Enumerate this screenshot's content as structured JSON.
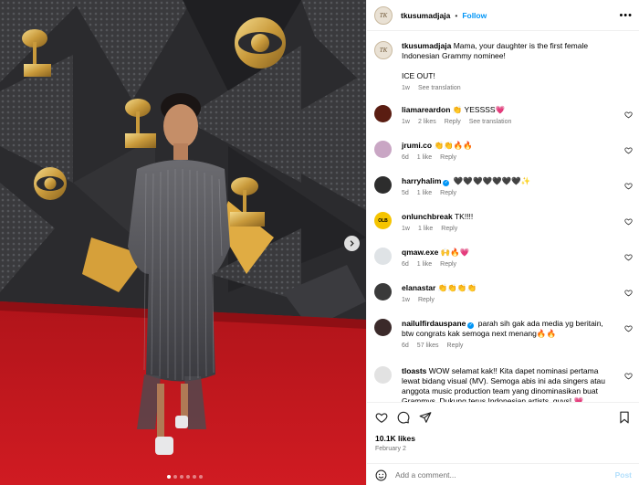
{
  "post": {
    "username": "tkusumadjaja",
    "separator": "•",
    "follow_label": "Follow",
    "more_label": "•••",
    "caption_line1": "Mama, your daughter is the first female Indonesian Grammy nominee!",
    "caption_line2": "ICE OUT!",
    "caption_time": "1w",
    "see_translation": "See translation",
    "avatar_text": "TK",
    "slide_count": 6,
    "active_slide": 0
  },
  "comments": [
    {
      "user": "liamareardon",
      "text": "👏 YESSSS💗",
      "time": "1w",
      "likes": "2 likes",
      "reply": "Reply",
      "translation": "See translation",
      "avatar_color": "#5a1d12",
      "verified": false
    },
    {
      "user": "jrumi.co",
      "text": "👏👏🔥🔥",
      "time": "6d",
      "likes": "1 like",
      "reply": "Reply",
      "avatar_color": "#c9a6c4",
      "verified": false
    },
    {
      "user": "harryhalim",
      "text": "🖤🖤🖤🖤🖤🖤🖤✨",
      "time": "5d",
      "likes": "1 like",
      "reply": "Reply",
      "avatar_color": "#2d2d2d",
      "verified": true
    },
    {
      "user": "onlunchbreak",
      "text": "TK!!!!",
      "time": "1w",
      "likes": "1 like",
      "reply": "Reply",
      "avatar_color": "#f5c400",
      "avatar_label": "OLB",
      "verified": false
    },
    {
      "user": "qmaw.exe",
      "text": "🙌🔥💗",
      "time": "6d",
      "likes": "1 like",
      "reply": "Reply",
      "avatar_color": "#dfe3e6",
      "verified": false
    },
    {
      "user": "elanastar",
      "text": "👏👏👏👏",
      "time": "1w",
      "reply": "Reply",
      "avatar_color": "#3a3a3a",
      "verified": false
    },
    {
      "user": "nailulfirdauspane",
      "text": "parah sih gak ada media yg beritain, btw congrats kak semoga next menang🔥🔥",
      "time": "6d",
      "likes": "57 likes",
      "reply": "Reply",
      "avatar_color": "#3b2a2a",
      "verified": true
    },
    {
      "user": "tloasts",
      "text": "WOW selamat kak!! Kita dapet nominasi pertama lewat bidang visual (MV). Semoga abis ini ada singers atau anggota music production team yang dinominasikan buat Grammys. Dukung terus Indonesian artists, guys! 💗",
      "avatar_color": "#e2e2e2",
      "verified": false
    }
  ],
  "footer": {
    "likes": "10.1K likes",
    "date": "February 2",
    "add_placeholder": "Add a comment...",
    "post_label": "Post"
  },
  "icons": [
    "heart-icon",
    "comment-icon",
    "share-icon",
    "bookmark-icon",
    "emoji-icon",
    "chevron-right-icon",
    "more-icon",
    "verified-icon"
  ],
  "colors": {
    "follow": "#0095f6",
    "muted": "#737373",
    "post_disabled": "#b2dffc",
    "carpet": "#c4161c"
  }
}
